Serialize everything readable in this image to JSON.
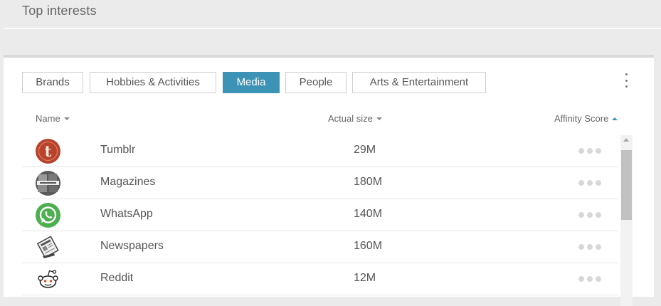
{
  "section": {
    "title": "Top interests"
  },
  "tabs": [
    {
      "label": "Brands",
      "active": false
    },
    {
      "label": "Hobbies & Activities",
      "active": false
    },
    {
      "label": "Media",
      "active": true
    },
    {
      "label": "People",
      "active": false
    },
    {
      "label": "Arts & Entertainment",
      "active": false
    }
  ],
  "menu": {
    "icon": "kebab-menu-icon"
  },
  "table": {
    "columns": {
      "name": "Name",
      "size": "Actual size",
      "score": "Affinity Score"
    },
    "sort": {
      "name": "descending",
      "size": "descending",
      "score": "ascending"
    },
    "rows": [
      {
        "icon": "tumblr-logo-icon",
        "name": "Tumblr",
        "size": "29M",
        "affinity_dots": 3
      },
      {
        "icon": "magazines-icon",
        "name": "Magazines",
        "size": "180M",
        "affinity_dots": 3
      },
      {
        "icon": "whatsapp-logo-icon",
        "name": "WhatsApp",
        "size": "140M",
        "affinity_dots": 3
      },
      {
        "icon": "newspaper-icon",
        "name": "Newspapers",
        "size": "160M",
        "affinity_dots": 3
      },
      {
        "icon": "reddit-logo-icon",
        "name": "Reddit",
        "size": "12M",
        "affinity_dots": 3
      }
    ]
  },
  "colors": {
    "accent": "#3d93b5",
    "tumblr": "#b8432c",
    "whatsapp": "#4caf50",
    "dot_inactive": "#d8d8d8"
  }
}
